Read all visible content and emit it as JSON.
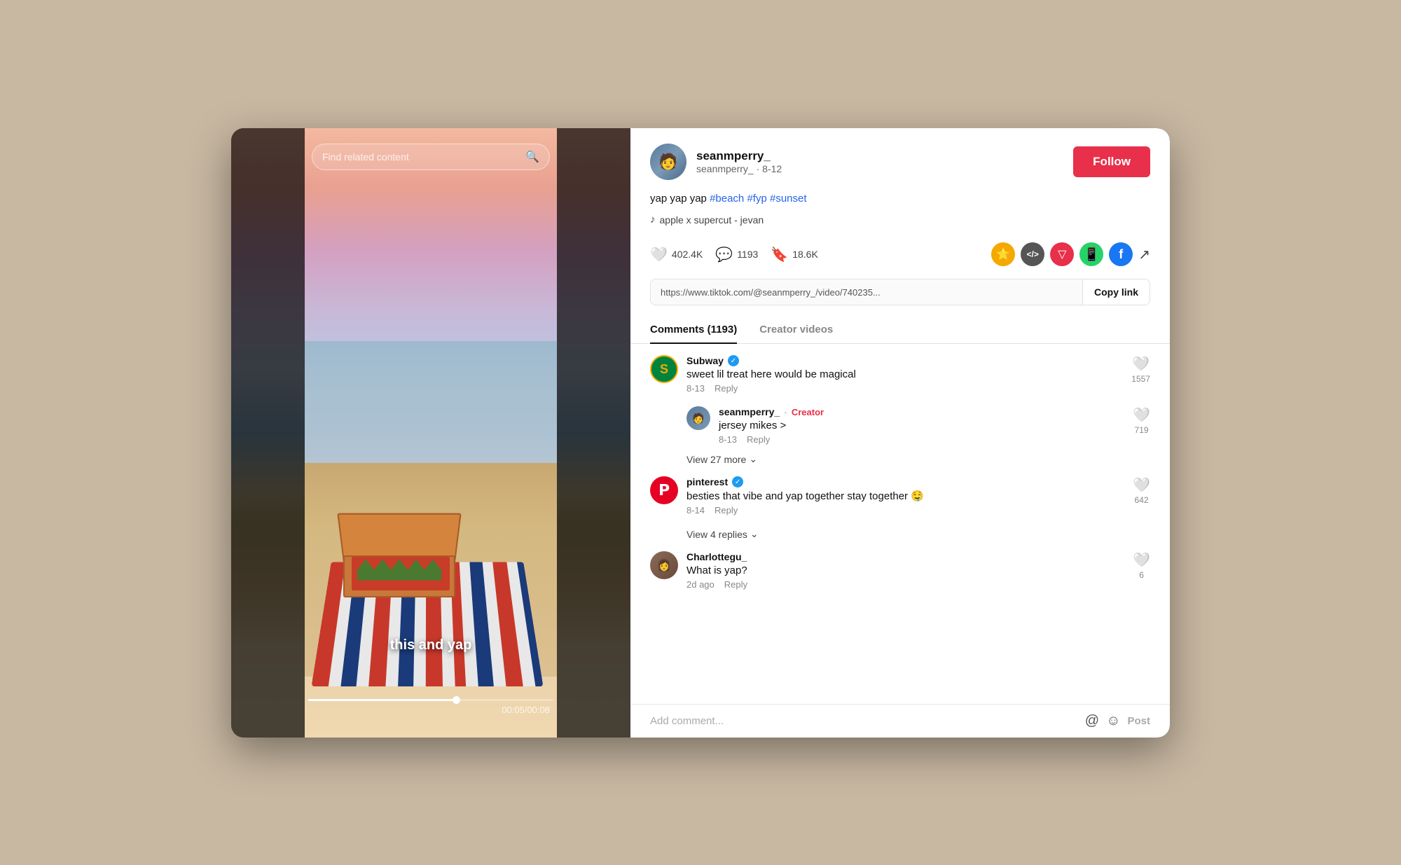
{
  "app": {
    "background_color": "#c8b8a2"
  },
  "search": {
    "placeholder": "Find related content"
  },
  "video": {
    "caption": "this and yap",
    "time_current": "00:05",
    "time_total": "00:08",
    "time_display": "00:05/00:08",
    "progress_percent": 62
  },
  "user": {
    "username": "seanmperry_",
    "date": "seanmperry_ · 8-12",
    "avatar_emoji": "🧑"
  },
  "follow_btn": "Follow",
  "description": {
    "text_before": "yap yap yap ",
    "hashtags": [
      "#beach",
      "#fyp",
      "#sunset"
    ],
    "full": "yap yap yap #beach #fyp #sunset"
  },
  "music": {
    "label": "apple x supercut - jevan"
  },
  "stats": {
    "likes": "402.4K",
    "comments": "1193",
    "bookmarks": "18.6K"
  },
  "link": {
    "url": "https://www.tiktok.com/@seanmperry_/video/740235...",
    "copy_label": "Copy link"
  },
  "tabs": [
    {
      "label": "Comments (1193)",
      "active": true
    },
    {
      "label": "Creator videos",
      "active": false
    }
  ],
  "comments": [
    {
      "id": "subway",
      "username": "Subway",
      "verified": true,
      "creator": false,
      "date": "8-13",
      "text": "sweet lil treat here would be magical",
      "likes": "1557",
      "replies": [
        {
          "username": "seanmperry_",
          "creator_tag": "Creator",
          "date": "8-13",
          "text": "jersey mikes >",
          "likes": "719"
        }
      ],
      "view_more": "View 27 more"
    },
    {
      "id": "pinterest",
      "username": "pinterest",
      "verified": true,
      "creator": false,
      "date": "8-14",
      "text": "besties that vibe and yap together stay together 🤤",
      "likes": "642",
      "view_more": "View 4 replies"
    },
    {
      "id": "charlottegu",
      "username": "Charlottegu_",
      "verified": false,
      "creator": false,
      "date": "2d ago",
      "text": "What is yap?",
      "likes": "6"
    }
  ],
  "comment_input": {
    "placeholder": "Add comment..."
  },
  "post_label": "Post",
  "share_icons": [
    {
      "name": "tiktok-coins",
      "bg": "#f5a800",
      "label": "⭐"
    },
    {
      "name": "code-share",
      "bg": "#555",
      "label": "</>"
    },
    {
      "name": "red-share",
      "bg": "#e8304a",
      "label": "▽"
    },
    {
      "name": "whatsapp-share",
      "bg": "#25d366",
      "label": "📞"
    },
    {
      "name": "facebook-share",
      "bg": "#1877f2",
      "label": "f"
    }
  ]
}
